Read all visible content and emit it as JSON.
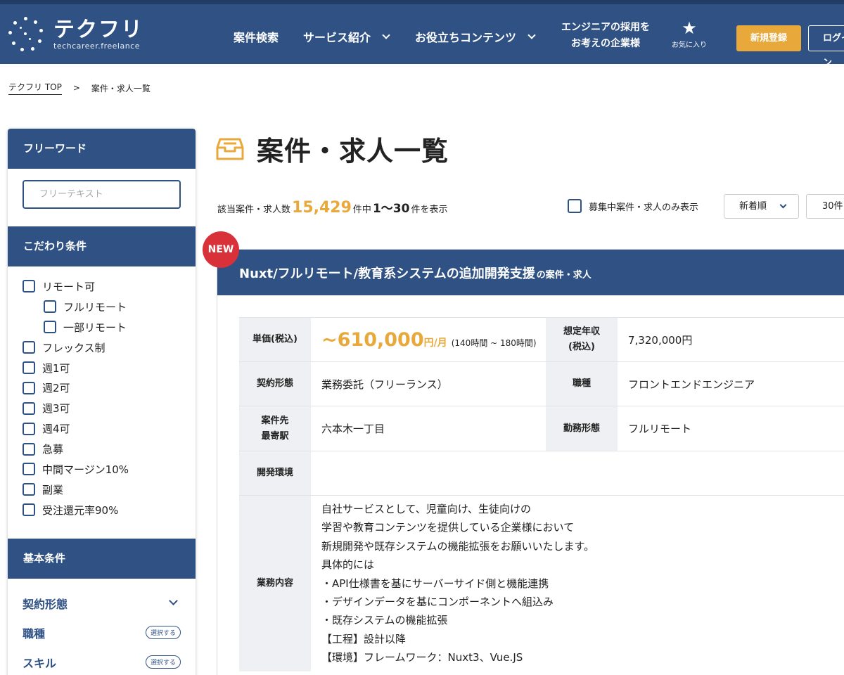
{
  "header": {
    "logo_title": "テクフリ",
    "logo_sub": "techcareer.freelance",
    "nav": [
      {
        "label": "案件検索"
      },
      {
        "label": "サービス紹介"
      },
      {
        "label": "お役立ちコンテンツ"
      }
    ],
    "employer_line1": "エンジニアの採用を",
    "employer_line2": "お考えの企業様",
    "favorites_label": "お気に入り",
    "register_label": "新規登録",
    "login_label": "ログイン",
    "colors": {
      "primary": "#2f5184",
      "accent": "#e8a93a",
      "new_badge": "#d9313a"
    }
  },
  "breadcrumb": {
    "home": "テクフリ TOP",
    "separator": ">",
    "current": "案件・求人一覧"
  },
  "sidebar": {
    "freeword_heading": "フリーワード",
    "freeword_placeholder": "フリーテキスト",
    "conditions_heading": "こだわり条件",
    "conditions": [
      {
        "label": "リモート可",
        "checked": false
      },
      {
        "label": "フルリモート",
        "checked": false
      },
      {
        "label": "一部リモート",
        "checked": false
      },
      {
        "label": "フレックス制",
        "checked": false
      },
      {
        "label": "週1可",
        "checked": false
      },
      {
        "label": "週2可",
        "checked": false
      },
      {
        "label": "週3可",
        "checked": false
      },
      {
        "label": "週4可",
        "checked": false
      },
      {
        "label": "急募",
        "checked": false
      },
      {
        "label": "中間マージン10%",
        "checked": false
      },
      {
        "label": "副業",
        "checked": false
      },
      {
        "label": "受注還元率90%",
        "checked": false
      }
    ],
    "basic_heading": "基本条件",
    "basic": [
      {
        "label": "契約形態"
      },
      {
        "label": "職種",
        "pill": "選択する"
      },
      {
        "label": "スキル",
        "pill": "選択する"
      }
    ]
  },
  "main": {
    "title": "案件・求人一覧",
    "count_prefix": "該当案件・求人数",
    "count_total": "15,429",
    "count_mid": "件中",
    "count_range": "1〜30",
    "count_suffix": "件を表示",
    "recruiting_only_label": "募集中案件・求人のみ表示",
    "sort_value": "新着順",
    "per_page_value": "30件"
  },
  "job": {
    "badge": "NEW",
    "title": "Nuxt/フルリモート/教育系システムの追加開発支援",
    "title_suffix": "の案件・求人",
    "price_label": "単価(税込)",
    "price_value": "~610,000",
    "price_unit": "円/月",
    "price_hours": "(140時間 ~ 180時間)",
    "annual_label_1": "想定年収",
    "annual_label_2": "(税込)",
    "annual_value": "7,320,000円",
    "contract_label": "契約形態",
    "contract_value": "業務委託（フリーランス）",
    "role_label": "職種",
    "role_value": "フロントエンドエンジニア",
    "station_label_1": "案件先",
    "station_label_2": "最寄駅",
    "station_value": "六本木一丁目",
    "workstyle_label": "勤務形態",
    "workstyle_value": "フルリモート",
    "env_label": "開発環境",
    "env_value": "",
    "desc_label": "業務内容",
    "desc_lines": [
      "自社サービスとして、児童向け、生徒向けの",
      "学習や教育コンテンツを提供している企業様において",
      "新規開発や既存システムの機能拡張をお願いいたします。",
      "具体的には",
      "・API仕様書を基にサーバーサイド側と機能連携",
      "・デザインデータを基にコンポーネントへ組込み",
      "・既存システムの機能拡張",
      "【工程】設計以降",
      "【環境】フレームワーク：Nuxt3、Vue.JS"
    ]
  }
}
